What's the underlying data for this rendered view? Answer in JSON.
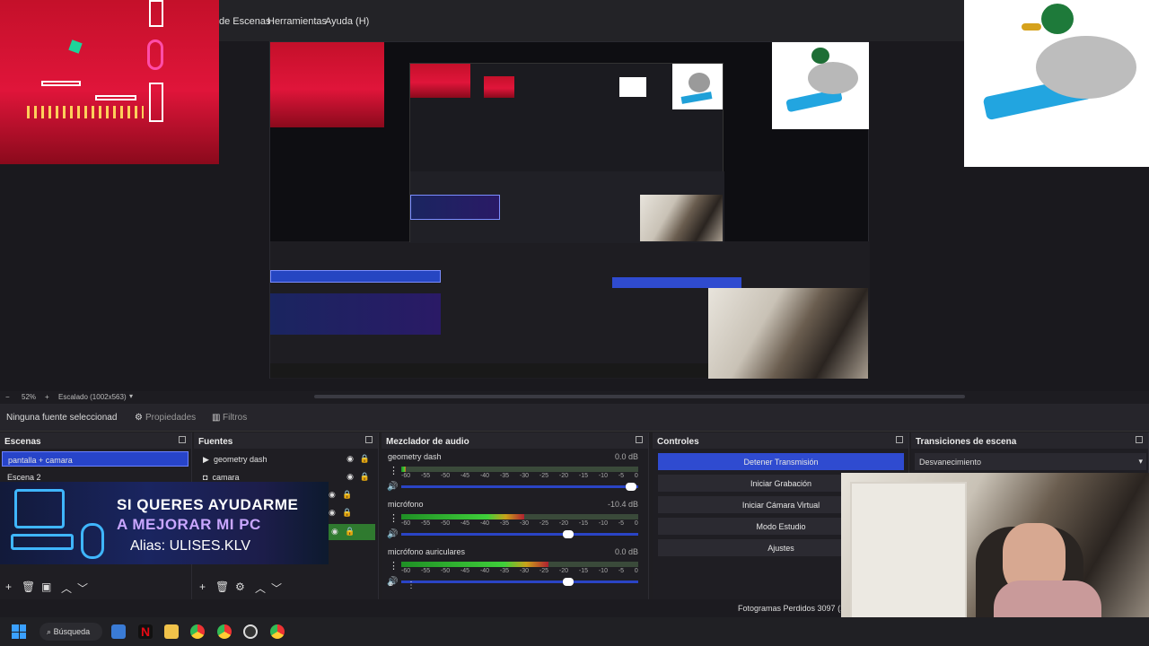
{
  "menu": {
    "items": [
      "de Escenas",
      "Herramientas",
      "Ayuda (H)"
    ]
  },
  "zoom": {
    "percent": "52%",
    "scale": "Escalado (1002x563)"
  },
  "source_bar": {
    "no_source": "Ninguna fuente seleccionad",
    "properties": "Propiedades",
    "filters": "Filtros"
  },
  "scenes": {
    "title": "Escenas",
    "items": [
      "pantalla + camara",
      "Escena 2"
    ]
  },
  "sources": {
    "title": "Fuentes",
    "items": [
      "geometry dash",
      "camara"
    ]
  },
  "mixer": {
    "title": "Mezclador de audio",
    "channels": [
      {
        "name": "geometry dash",
        "db": "0.0 dB"
      },
      {
        "name": "micrófono",
        "db": "-10.4 dB"
      },
      {
        "name": "micrófono auriculares",
        "db": "0.0 dB"
      }
    ],
    "ticks": [
      "-60",
      "-55",
      "-50",
      "-45",
      "-40",
      "-35",
      "-30",
      "-25",
      "-20",
      "-15",
      "-10",
      "-5",
      "0"
    ]
  },
  "controls": {
    "title": "Controles",
    "buttons": [
      "Detener Transmisión",
      "Iniciar Grabación",
      "Iniciar Cámara Virtual",
      "Modo Estudio",
      "Ajustes"
    ]
  },
  "transitions": {
    "title": "Transiciones de escena",
    "selected": "Desvanecimiento"
  },
  "status": {
    "dropped": "Fotogramas Perdidos 3097 (1"
  },
  "banner": {
    "line1": "SI QUERES AYUDARME",
    "line2": "A MEJORAR MI PC",
    "line3": "Alias: ULISES.KLV"
  },
  "taskbar": {
    "search": "Búsqueda"
  },
  "colors": {
    "accent": "#2f4bd0",
    "meter_green": "#3fcf3a",
    "meter_yellow": "#c9a21a",
    "meter_red": "#b02030"
  }
}
